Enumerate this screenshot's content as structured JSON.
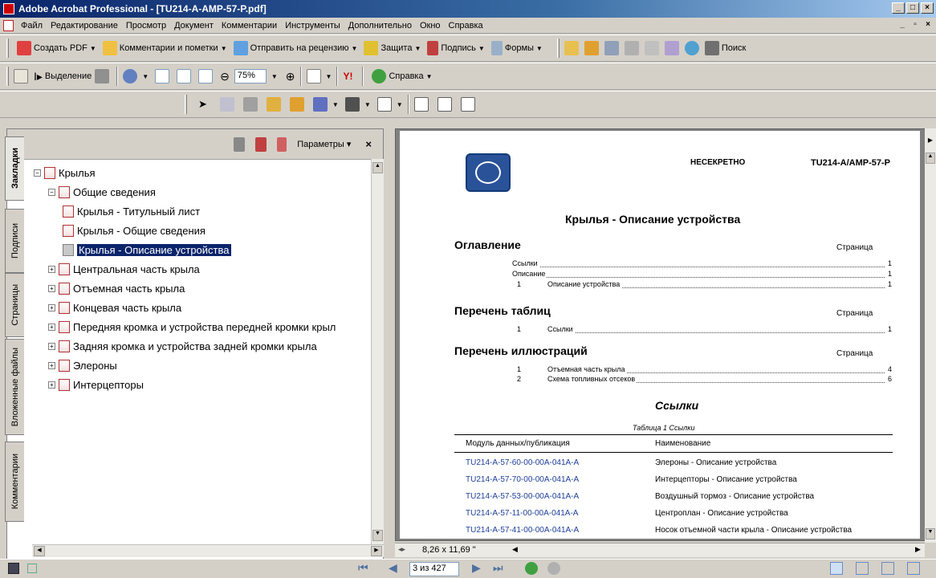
{
  "window": {
    "title": "Adobe Acrobat Professional - [TU214-A-AMP-57-P.pdf]"
  },
  "menu": [
    "Файл",
    "Редактирование",
    "Просмотр",
    "Документ",
    "Комментарии",
    "Инструменты",
    "Дополнительно",
    "Окно",
    "Справка"
  ],
  "toolbar1": {
    "create_pdf": "Создать PDF",
    "comments": "Комментарии и пометки",
    "send_review": "Отправить на рецензию",
    "security": "Защита",
    "sign": "Подпись",
    "forms": "Формы",
    "search": "Поиск"
  },
  "toolbar2": {
    "select": "Выделение",
    "zoom": "75%",
    "help": "Справка"
  },
  "nav": {
    "options": "Параметры",
    "close": "×"
  },
  "sidetabs": [
    "Закладки",
    "Подписи",
    "Страницы",
    "Вложенные файлы",
    "Комментарии"
  ],
  "tree": [
    {
      "label": "Крылья",
      "sign": "⊟"
    },
    {
      "label": "Общие сведения",
      "sign": "⊟"
    },
    {
      "label": "Крылья - Титульный лист"
    },
    {
      "label": "Крылья - Общие сведения"
    },
    {
      "label": "Крылья - Описание устройства"
    },
    {
      "label": "Центральная часть крыла",
      "sign": "⊞"
    },
    {
      "label": "Отъемная часть крыла",
      "sign": "⊞"
    },
    {
      "label": "Концевая часть крыла",
      "sign": "⊞"
    },
    {
      "label": "Передняя кромка и устройства передней кромки крыл",
      "sign": "⊞"
    },
    {
      "label": "Задняя кромка и устройства задней кромки крыла",
      "sign": "⊞"
    },
    {
      "label": "Элероны",
      "sign": "⊞"
    },
    {
      "label": "Интерцепторы",
      "sign": "⊞"
    }
  ],
  "doc": {
    "classification": "НЕСЕКРЕТНО",
    "code": "TU214-A/AMP-57-P",
    "title": "Крылья - Описание устройства",
    "toc_heading": "Оглавление",
    "page_word": "Страница",
    "toc": [
      {
        "num": "",
        "label": "Ссылки",
        "page": "1"
      },
      {
        "num": "",
        "label": "Описание",
        "page": "1"
      },
      {
        "num": "1",
        "label": "Описание устройства",
        "page": "1"
      }
    ],
    "tables_heading": "Перечень таблиц",
    "tables": [
      {
        "num": "1",
        "label": "Ссылки",
        "page": "1"
      }
    ],
    "figs_heading": "Перечень иллюстраций",
    "figs": [
      {
        "num": "1",
        "label": "Отъемная часть крыла",
        "page": "4"
      },
      {
        "num": "2",
        "label": "Схема топливных отсеков",
        "page": "6"
      }
    ],
    "refs_heading": "Ссылки",
    "table_caption": "Таблица 1   Ссылки",
    "col1": "Модуль данных/публикация",
    "col2": "Наименование",
    "rows": [
      {
        "code": "TU214-A-57-60-00-00A-041A-A",
        "name": "Элероны - Описание устройства"
      },
      {
        "code": "TU214-A-57-70-00-00A-041A-A",
        "name": "Интерцепторы - Описание устройства"
      },
      {
        "code": "TU214-A-57-53-00-00A-041A-A",
        "name": "Воздушный тормоз - Описание устройства"
      },
      {
        "code": "TU214-A-57-11-00-00A-041A-A",
        "name": "Центроплан - Описание устройства"
      },
      {
        "code": "TU214-A-57-41-00-00A-041A-A",
        "name": "Носок отъемной части крыла - Описание устройства"
      }
    ]
  },
  "status": {
    "page_size": "8,26 x 11,69 \"",
    "page_of": "3 из 427"
  },
  "colors": {
    "selection": "#0a246a",
    "link": "#1c3e9a"
  }
}
